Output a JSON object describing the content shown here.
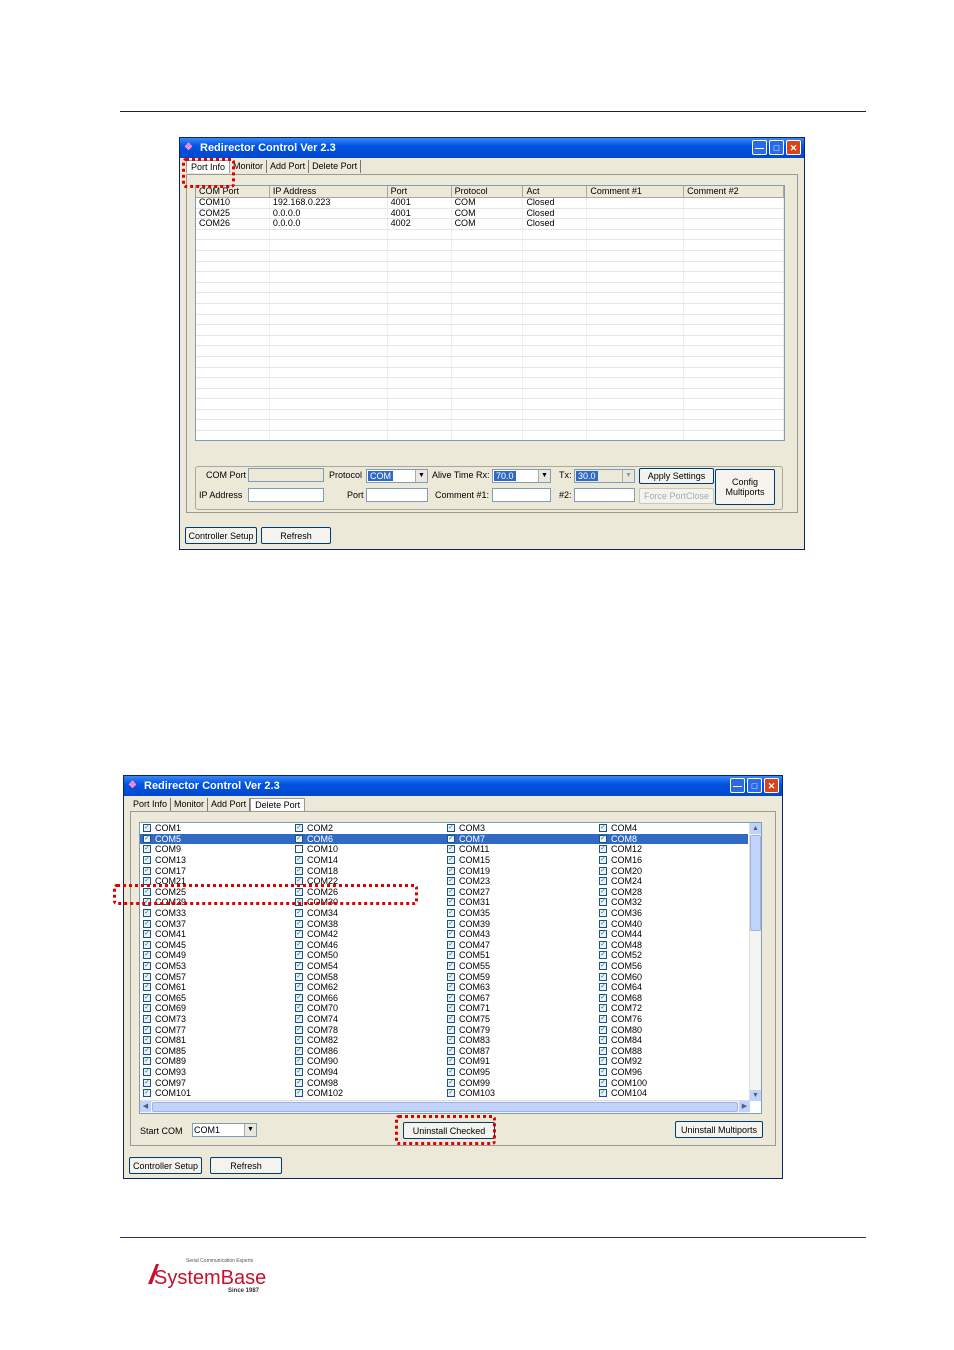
{
  "window1": {
    "title": "Redirector Control Ver 2.3",
    "tabs": [
      "Port Info",
      "Monitor",
      "Add Port",
      "Delete Port"
    ],
    "columns": [
      "COM Port",
      "IP Address",
      "Port",
      "Protocol",
      "Act",
      "Comment #1",
      "Comment #2"
    ],
    "rows": [
      [
        "COM10",
        "192.168.0.223",
        "4001",
        "COM",
        "Closed",
        "",
        ""
      ],
      [
        "COM25",
        "0.0.0.0",
        "4001",
        "COM",
        "Closed",
        "",
        ""
      ],
      [
        "COM26",
        "0.0.0.0",
        "4002",
        "COM",
        "Closed",
        "",
        ""
      ]
    ],
    "form": {
      "com_port_label": "COM Port",
      "protocol_label": "Protocol",
      "protocol_value": "COM",
      "alive_rx_label": "Alive Time Rx:",
      "alive_rx_value": "70.0",
      "tx_label": "Tx:",
      "tx_value": "30.0",
      "apply_label": "Apply Settings",
      "config_label_1": "Config",
      "config_label_2": "Multiports",
      "ip_label": "IP Address",
      "port_label": "Port",
      "comment1_label": "Comment #1:",
      "comment2_label": "#2:",
      "force_close_label": "Force PortClose"
    },
    "controller_setup": "Controller Setup",
    "refresh": "Refresh"
  },
  "window2": {
    "title": "Redirector Control Ver 2.3",
    "tabs": [
      "Port Info",
      "Monitor",
      "Add Port",
      "Delete Port"
    ],
    "ports": [
      [
        "COM1",
        "COM2",
        "COM3",
        "COM4"
      ],
      [
        "COM5",
        "COM6",
        "COM7",
        "COM8"
      ],
      [
        "COM9",
        "COM10",
        "COM11",
        "COM12"
      ],
      [
        "COM13",
        "COM14",
        "COM15",
        "COM16"
      ],
      [
        "COM17",
        "COM18",
        "COM19",
        "COM20"
      ],
      [
        "COM21",
        "COM22",
        "COM23",
        "COM24"
      ],
      [
        "COM25",
        "COM26",
        "COM27",
        "COM28"
      ],
      [
        "COM29",
        "COM30",
        "COM31",
        "COM32"
      ],
      [
        "COM33",
        "COM34",
        "COM35",
        "COM36"
      ],
      [
        "COM37",
        "COM38",
        "COM39",
        "COM40"
      ],
      [
        "COM41",
        "COM42",
        "COM43",
        "COM44"
      ],
      [
        "COM45",
        "COM46",
        "COM47",
        "COM48"
      ],
      [
        "COM49",
        "COM50",
        "COM51",
        "COM52"
      ],
      [
        "COM53",
        "COM54",
        "COM55",
        "COM56"
      ],
      [
        "COM57",
        "COM58",
        "COM59",
        "COM60"
      ],
      [
        "COM61",
        "COM62",
        "COM63",
        "COM64"
      ],
      [
        "COM65",
        "COM66",
        "COM67",
        "COM68"
      ],
      [
        "COM69",
        "COM70",
        "COM71",
        "COM72"
      ],
      [
        "COM73",
        "COM74",
        "COM75",
        "COM76"
      ],
      [
        "COM77",
        "COM78",
        "COM79",
        "COM80"
      ],
      [
        "COM81",
        "COM82",
        "COM83",
        "COM84"
      ],
      [
        "COM85",
        "COM86",
        "COM87",
        "COM88"
      ],
      [
        "COM89",
        "COM90",
        "COM91",
        "COM92"
      ],
      [
        "COM93",
        "COM94",
        "COM95",
        "COM96"
      ],
      [
        "COM97",
        "COM98",
        "COM99",
        "COM100"
      ],
      [
        "COM101",
        "COM102",
        "COM103",
        "COM104"
      ]
    ],
    "highlighted_row": 1,
    "unchecked": [
      "COM10"
    ],
    "start_com_label": "Start COM",
    "start_com_value": "COM1",
    "uninstall_checked": "Uninstall Checked",
    "uninstall_multiports": "Uninstall Multiports",
    "controller_setup": "Controller Setup",
    "refresh": "Refresh"
  },
  "footer": {
    "logo_tagline": "Serial Communication Experts",
    "logo_name": "SystemBase",
    "logo_since": "Since 1987",
    "brand_color": "#c8102e"
  }
}
